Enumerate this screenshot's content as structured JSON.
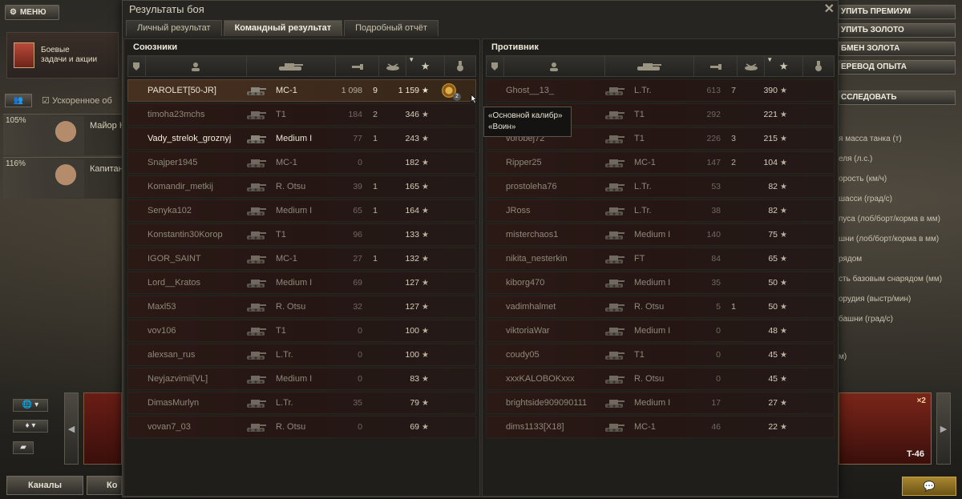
{
  "hangar": {
    "menu_label": "МЕНЮ",
    "missions_line1": "Боевые",
    "missions_line2": "задачи и акции",
    "crew_toggle_label": "👥",
    "crew_checkbox_label": "Ускоренное об",
    "crew": [
      {
        "pct": "105%",
        "rank": "Майор К"
      },
      {
        "pct": "116%",
        "rank": "Капитан"
      }
    ],
    "channels_label": "Каналы",
    "second_btn_label": "Ко",
    "right_buttons": [
      "УПИТЬ ПРЕМИУМ",
      "УПИТЬ ЗОЛОТО",
      "БМЕН ЗОЛОТА",
      "ЕРЕВОД ОПЫТА"
    ],
    "research_label": "ССЛЕДОВАТЬ",
    "specs": [
      "я масса танка (т)",
      "еля (л.с.)",
      "орость (км/ч)",
      "шасси (град/с)",
      "пуса (лоб/борт/корма в мм)",
      "шни (лоб/борт/корма в мм)",
      "рядом",
      "сть базовым снарядом (мм)",
      "орудия (выстр/мин)",
      "башни (град/с)",
      "м)"
    ],
    "tank_card_name": "T-46",
    "tank_card_mult": "×2"
  },
  "window": {
    "title": "Результаты боя",
    "close": "✕",
    "tabs": [
      "Личный результат",
      "Командный результат",
      "Подробный отчёт"
    ],
    "active_tab": 1
  },
  "allies": {
    "title": "Союзники",
    "rows": [
      {
        "name": "PAROLET[50-JR]",
        "tank": "MC-1",
        "damage": "1 098",
        "kills": "9",
        "xp": "1 159",
        "state": "player",
        "medal": "2"
      },
      {
        "name": "timoha23mchs",
        "tank": "T1",
        "damage": "184",
        "kills": "2",
        "xp": "346",
        "state": "dead"
      },
      {
        "name": "Vady_strelok_groznyj",
        "tank": "Medium I",
        "damage": "77",
        "kills": "1",
        "xp": "243",
        "state": "alive"
      },
      {
        "name": "Snajper1945",
        "tank": "MC-1",
        "damage": "0",
        "kills": "",
        "xp": "182",
        "state": "dead"
      },
      {
        "name": "Komandir_metkij",
        "tank": "R. Otsu",
        "damage": "39",
        "kills": "1",
        "xp": "165",
        "state": "dead"
      },
      {
        "name": "Senyka102",
        "tank": "Medium I",
        "damage": "65",
        "kills": "1",
        "xp": "164",
        "state": "dead"
      },
      {
        "name": "Konstantin30Korop",
        "tank": "T1",
        "damage": "96",
        "kills": "",
        "xp": "133",
        "state": "dead"
      },
      {
        "name": "IGOR_SAINT",
        "tank": "MC-1",
        "damage": "27",
        "kills": "1",
        "xp": "132",
        "state": "dead"
      },
      {
        "name": "Lord__Kratos",
        "tank": "Medium I",
        "damage": "69",
        "kills": "",
        "xp": "127",
        "state": "dead"
      },
      {
        "name": "Maxl53",
        "tank": "R. Otsu",
        "damage": "32",
        "kills": "",
        "xp": "127",
        "state": "dead"
      },
      {
        "name": "vov106",
        "tank": "T1",
        "damage": "0",
        "kills": "",
        "xp": "100",
        "state": "dead"
      },
      {
        "name": "alexsan_rus",
        "tank": "L.Tr.",
        "damage": "0",
        "kills": "",
        "xp": "100",
        "state": "dead"
      },
      {
        "name": "Neyjazvimii[VL]",
        "tank": "Medium I",
        "damage": "0",
        "kills": "",
        "xp": "83",
        "state": "dead"
      },
      {
        "name": "DimasMurlyn",
        "tank": "L.Tr.",
        "damage": "35",
        "kills": "",
        "xp": "79",
        "state": "dead"
      },
      {
        "name": "vovan7_03",
        "tank": "R. Otsu",
        "damage": "0",
        "kills": "",
        "xp": "69",
        "state": "dead"
      }
    ]
  },
  "enemies": {
    "title": "Противник",
    "rows": [
      {
        "name": "Ghost__13_",
        "tank": "L.Tr.",
        "damage": "613",
        "kills": "7",
        "xp": "390",
        "state": "dead"
      },
      {
        "name": "",
        "tank": "T1",
        "damage": "292",
        "kills": "",
        "xp": "221",
        "state": "dead"
      },
      {
        "name": "vorobej72",
        "tank": "T1",
        "damage": "226",
        "kills": "3",
        "xp": "215",
        "state": "dead"
      },
      {
        "name": "Ripper25",
        "tank": "MC-1",
        "damage": "147",
        "kills": "2",
        "xp": "104",
        "state": "dead"
      },
      {
        "name": "prostoleha76",
        "tank": "L.Tr.",
        "damage": "53",
        "kills": "",
        "xp": "82",
        "state": "dead"
      },
      {
        "name": "JRoss",
        "tank": "L.Tr.",
        "damage": "38",
        "kills": "",
        "xp": "82",
        "state": "dead"
      },
      {
        "name": "misterchaos1",
        "tank": "Medium I",
        "damage": "140",
        "kills": "",
        "xp": "75",
        "state": "dead"
      },
      {
        "name": "nikita_nesterkin",
        "tank": "FT",
        "damage": "84",
        "kills": "",
        "xp": "65",
        "state": "dead"
      },
      {
        "name": "kiborg470",
        "tank": "Medium I",
        "damage": "35",
        "kills": "",
        "xp": "50",
        "state": "dead"
      },
      {
        "name": "vadimhalmet",
        "tank": "R. Otsu",
        "damage": "5",
        "kills": "1",
        "xp": "50",
        "state": "dead"
      },
      {
        "name": "viktoriaWar",
        "tank": "Medium I",
        "damage": "0",
        "kills": "",
        "xp": "48",
        "state": "dead"
      },
      {
        "name": "coudy05",
        "tank": "T1",
        "damage": "0",
        "kills": "",
        "xp": "45",
        "state": "dead"
      },
      {
        "name": "xxxKALOBOKxxx",
        "tank": "R. Otsu",
        "damage": "0",
        "kills": "",
        "xp": "45",
        "state": "dead"
      },
      {
        "name": "brightside909090111",
        "tank": "Medium I",
        "damage": "17",
        "kills": "",
        "xp": "27",
        "state": "dead"
      },
      {
        "name": "dims1133[X18]",
        "tank": "MC-1",
        "damage": "46",
        "kills": "",
        "xp": "22",
        "state": "dead"
      }
    ]
  },
  "tooltip": {
    "line1": "«Основной калибр»",
    "line2": "«Воин»"
  },
  "colors": {
    "player_row": "#473020",
    "row_bg": "#2b1915",
    "text_alive": "#f3eede",
    "text_dead": "#8f897a"
  }
}
